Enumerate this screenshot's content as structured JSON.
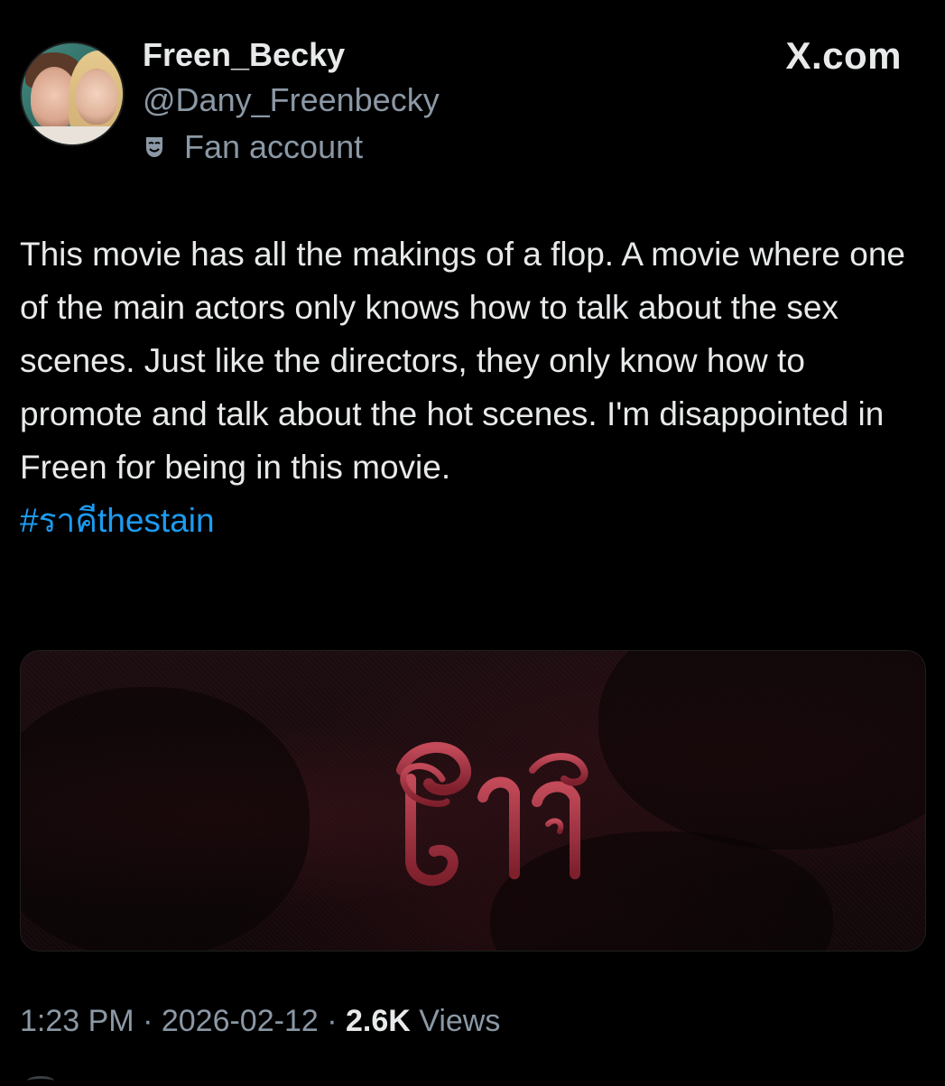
{
  "author": {
    "display_name": "Freen_Becky",
    "handle": "@Dany_Freenbecky",
    "account_label": "Fan account",
    "account_label_icon": "theater-mask-icon"
  },
  "watermark": "X.com",
  "tweet": {
    "text": "This movie has all the makings of a flop. A movie where one of the main actors only knows how to talk about the sex scenes. Just like the directors, they only know how to promote and talk about the hot scenes. I'm disappointed in Freen for being in this movie.",
    "hashtag": "#ราคีthestain",
    "media": {
      "logo_text": "ราคี"
    }
  },
  "meta": {
    "time": "1:23 PM",
    "separator": " · ",
    "date": "2026-02-12",
    "views_count": "2.6K",
    "views_label": " Views"
  },
  "colors": {
    "background": "#000000",
    "text_primary": "#e7e9ea",
    "text_secondary": "#8b98a5",
    "link": "#1d9bf0",
    "logo_red": "#a8303f"
  }
}
